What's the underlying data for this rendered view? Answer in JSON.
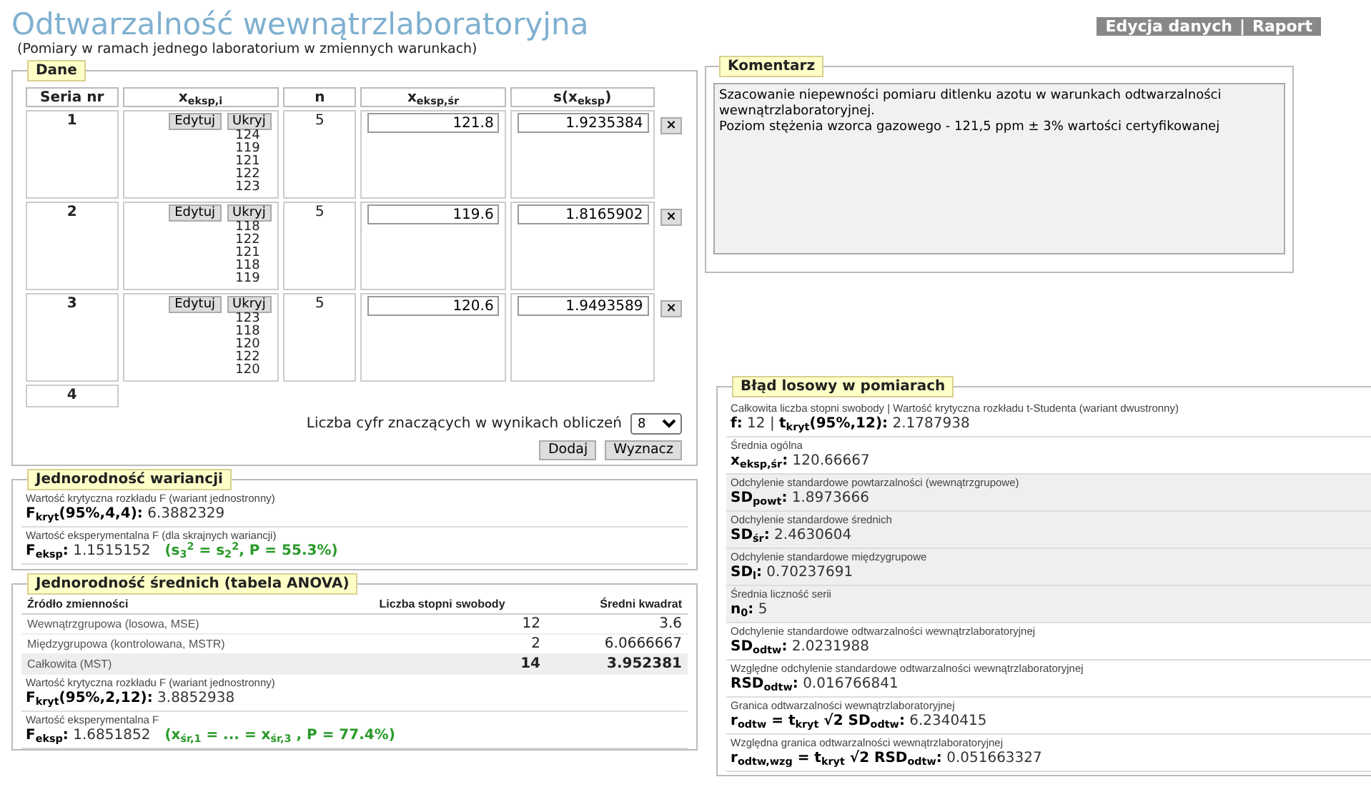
{
  "title": "Odtwarzalność wewnątrzlaboratoryjna",
  "subtitle": "(Pomiary w ramach jednego laboratorium w zmiennych warunkach)",
  "nav": {
    "links": [
      "Edycja danych",
      "Raport"
    ],
    "separator": "|"
  },
  "dane": {
    "legend": "Dane",
    "columns": [
      "Seria nr",
      "x$_{eksp,i}$",
      "n",
      "x$_{eksp,śr}$",
      "s(x$_{eksp}$)"
    ],
    "rows": [
      {
        "seria": "1",
        "buttons": [
          "Edytuj",
          "Ukryj"
        ],
        "values": [
          "124",
          "119",
          "121",
          "122",
          "123"
        ],
        "n": "5",
        "mean": "121.8",
        "sd": "1.9235384",
        "remove": "×"
      },
      {
        "seria": "2",
        "buttons": [
          "Edytuj",
          "Ukryj"
        ],
        "values": [
          "118",
          "122",
          "121",
          "118",
          "119"
        ],
        "n": "5",
        "mean": "119.6",
        "sd": "1.8165902",
        "remove": "×"
      },
      {
        "seria": "3",
        "buttons": [
          "Edytuj",
          "Ukryj"
        ],
        "values": [
          "123",
          "118",
          "120",
          "122",
          "120"
        ],
        "n": "5",
        "mean": "120.6",
        "sd": "1.9493589",
        "remove": "×"
      }
    ],
    "new_seria": "4",
    "digits_label": "Liczba cyfr znaczących w wynikach obliczeń",
    "digits_value": "8",
    "actions": [
      "Dodaj",
      "Wyznacz"
    ]
  },
  "komentarz": {
    "legend": "Komentarz",
    "text": "Szacowanie niepewności pomiaru ditlenku azotu w warunkach odtwarzalności wewnątrzlaboratoryjnej.\nPoziom stężenia wzorca gazowego - 121,5 ppm ± 3% wartości certyfikowanej"
  },
  "wariancji": {
    "legend": "Jednorodność wariancji",
    "results": [
      {
        "caption": "Wartość krytyczna rozkładu F (wariant jednostronny)",
        "label": "F$_{kryt}$(95%,4,4):",
        "value": "6.3882329"
      },
      {
        "caption": "Wartość eksperymentalna F (dla skrajnych wariancji)",
        "label": "F$_{eksp}$:",
        "value": "1.1515152",
        "note": "(s$_{3}$$^{2}$ = s$_{2}$$^{2}$, P = 55.3%)"
      }
    ]
  },
  "anova": {
    "legend": "Jednorodność średnich (tabela ANOVA)",
    "columns": [
      "Źródło zmienności",
      "Liczba stopni swobody",
      "Średni kwadrat"
    ],
    "rows": [
      {
        "source": "Wewnątrzgrupowa (losowa, MSE)",
        "df": "12",
        "ms": "3.6",
        "total": false
      },
      {
        "source": "Międzygrupowa (kontrolowana, MSTR)",
        "df": "2",
        "ms": "6.0666667",
        "total": false
      },
      {
        "source": "Całkowita (MST)",
        "df": "14",
        "ms": "3.952381",
        "total": true
      }
    ],
    "results": [
      {
        "caption": "Wartość krytyczna rozkładu F (wariant jednostronny)",
        "label": "F$_{kryt}$(95%,2,12):",
        "value": "3.8852938"
      },
      {
        "caption": "Wartość eksperymentalna F",
        "label": "F$_{eksp}$:",
        "value": "1.6851852",
        "note": "(x$_{śr,1}$ = ... = x$_{śr,3}$ , P = 77.4%)"
      }
    ]
  },
  "blad": {
    "legend": "Błąd losowy w pomiarach",
    "results": [
      {
        "caption": "Całkowita liczba stopni swobody | Wartość krytyczna rozkładu t-Studenta (wariant dwustronny)",
        "label": "f:",
        "value": "12 |",
        "label2": "t$_{kryt}$(95%,12):",
        "value2": "2.1787938",
        "shaded": false
      },
      {
        "caption": "Średnia ogólna",
        "label": "x$_{eksp,śr}$:",
        "value": "120.66667",
        "shaded": false
      },
      {
        "caption": "Odchylenie standardowe powtarzalności (wewnątrzgrupowe)",
        "label": "SD$_{powt}$:",
        "value": "1.8973666",
        "shaded": true
      },
      {
        "caption": "Odchylenie standardowe średnich",
        "label": "SD$_{śr}$:",
        "value": "2.4630604",
        "shaded": true
      },
      {
        "caption": "Odchylenie standardowe międzygrupowe",
        "label": "SD$_{l}$:",
        "value": "0.70237691",
        "shaded": true
      },
      {
        "caption": "Średnia liczność serii",
        "label": "n$_{0}$:",
        "value": "5",
        "shaded": true
      },
      {
        "caption": "Odchylenie standardowe odtwarzalności wewnątrzlaboratoryjnej",
        "label": "SD$_{odtw}$:",
        "value": "2.0231988",
        "shaded": false
      },
      {
        "caption": "Względne odchylenie standardowe odtwarzalności wewnątrzlaboratoryjnej",
        "label": "RSD$_{odtw}$:",
        "value": "0.016766841",
        "shaded": false
      },
      {
        "caption": "Granica odtwarzalności wewnątrzlaboratoryjnej",
        "label": "r$_{odtw}$ = t$_{kryt}$ √2 SD$_{odtw}$:",
        "value": "6.2340415",
        "shaded": false
      },
      {
        "caption": "Względna granica odtwarzalności wewnątrzlaboratoryjnej",
        "label": "r$_{odtw,wzg}$ = t$_{kryt}$ √2 RSD$_{odtw}$:",
        "value": "0.051663327",
        "shaded": false
      }
    ]
  }
}
